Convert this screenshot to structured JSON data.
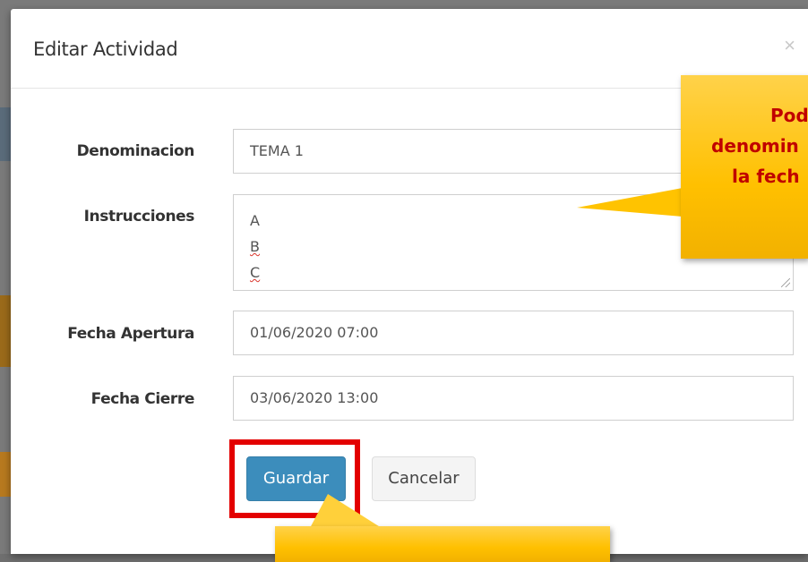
{
  "modal": {
    "title": "Editar Actividad",
    "close_glyph": "×"
  },
  "form": {
    "denominacion": {
      "label": "Denominacion",
      "value": "TEMA 1"
    },
    "instrucciones": {
      "label": "Instrucciones",
      "lines": [
        "A",
        "B",
        "C"
      ]
    },
    "fecha_apertura": {
      "label": "Fecha Apertura",
      "value": "01/06/2020 07:00"
    },
    "fecha_cierre": {
      "label": "Fecha Cierre",
      "value": "03/06/2020 13:00"
    }
  },
  "buttons": {
    "save_label": "Guardar",
    "cancel_label": "Cancelar"
  },
  "callouts": {
    "right": {
      "lines": [
        "Pod",
        "denomin",
        "la fech"
      ]
    }
  },
  "colors": {
    "primary": "#3c8dbc",
    "callout": "#ffc000",
    "callout_text": "#c00000",
    "highlight": "#e30000"
  }
}
